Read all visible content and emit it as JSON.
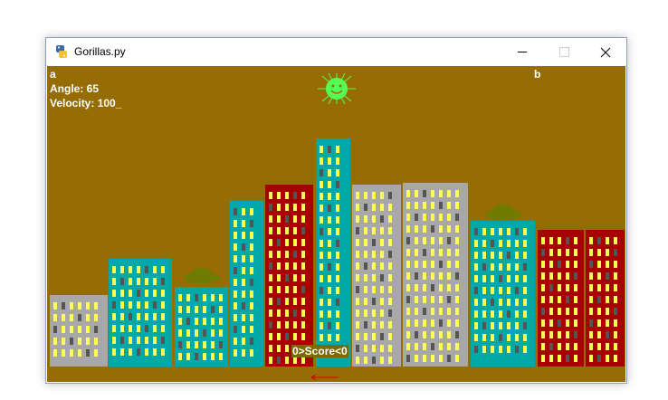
{
  "window": {
    "title": "Gorillas.py",
    "app_icon": "python-icon",
    "controls": {
      "minimize": "minimize-icon",
      "maximize": "maximize-icon",
      "close": "close-icon"
    }
  },
  "game": {
    "background_color": "#966c04",
    "player_left": "a",
    "player_right": "b",
    "angle_text": "Angle:  65",
    "velocity_text": "Velocity:  100_",
    "score_text": "0>Score<0",
    "sun_icon": "sun-icon",
    "gorilla_icon": "gorilla-icon",
    "banana_icon": "banana-icon",
    "colors": {
      "yellow_window": "#ffff54",
      "dark_window": "#555555",
      "sun": "#55ff55",
      "gorilla": "#6f7c00"
    },
    "buildings": [
      {
        "color": "#a8a8a8"
      },
      {
        "color": "#00a8a8"
      },
      {
        "color": "#00a8a8"
      },
      {
        "color": "#00a8a8"
      },
      {
        "color": "#a80000"
      },
      {
        "color": "#00a8a8"
      },
      {
        "color": "#a8a8a8"
      },
      {
        "color": "#a8a8a8"
      },
      {
        "color": "#00a8a8"
      },
      {
        "color": "#a80000"
      },
      {
        "color": "#a80000"
      }
    ]
  }
}
